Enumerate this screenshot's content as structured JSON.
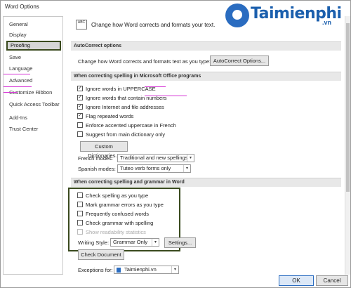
{
  "window": {
    "title": "Word Options"
  },
  "watermark": {
    "text": "Taimienphi",
    "suffix": ".vn"
  },
  "sidebar": {
    "items": [
      {
        "label": "General",
        "active": false
      },
      {
        "label": "Display",
        "active": false
      },
      {
        "label": "Proofing",
        "active": true
      },
      {
        "label": "Save",
        "active": false
      },
      {
        "label": "Language",
        "active": false
      },
      {
        "label": "Advanced",
        "active": false
      },
      {
        "label": "Customize Ribbon",
        "active": false
      },
      {
        "label": "Quick Access Toolbar",
        "active": false
      },
      {
        "label": "Add-Ins",
        "active": false
      },
      {
        "label": "Trust Center",
        "active": false
      }
    ]
  },
  "header": {
    "icon_text": "ABC",
    "text": "Change how Word corrects and formats your text."
  },
  "autocorrect": {
    "section_title": "AutoCorrect options",
    "description": "Change how Word corrects and formats text as you type:",
    "button_label": "AutoCorrect Options..."
  },
  "office_spelling": {
    "section_title": "When correcting spelling in Microsoft Office programs",
    "options": [
      {
        "label": "Ignore words in UPPERCASE",
        "checked": true
      },
      {
        "label": "Ignore words that contain numbers",
        "checked": true
      },
      {
        "label": "Ignore Internet and file addresses",
        "checked": true
      },
      {
        "label": "Flag repeated words",
        "checked": true
      },
      {
        "label": "Enforce accented uppercase in French",
        "checked": false
      },
      {
        "label": "Suggest from main dictionary only",
        "checked": false
      }
    ],
    "custom_dictionaries_label": "Custom Dictionaries...",
    "french_modes_label": "French modes:",
    "french_modes_value": "Traditional and new spellings",
    "spanish_modes_label": "Spanish modes:",
    "spanish_modes_value": "Tuteo verb forms only"
  },
  "word_spelling": {
    "section_title": "When correcting spelling and grammar in Word",
    "options": [
      {
        "label": "Check spelling as you type",
        "checked": false,
        "disabled": false
      },
      {
        "label": "Mark grammar errors as you type",
        "checked": false,
        "disabled": false
      },
      {
        "label": "Frequently confused words",
        "checked": false,
        "disabled": false
      },
      {
        "label": "Check grammar with spelling",
        "checked": false,
        "disabled": false
      },
      {
        "label": "Show readability statistics",
        "checked": false,
        "disabled": true
      }
    ],
    "writing_style_label": "Writing Style:",
    "writing_style_value": "Grammar Only",
    "settings_label": "Settings...",
    "check_document_label": "Check Document"
  },
  "exceptions": {
    "label": "Exceptions for:",
    "value": "Taimienphi.vn"
  },
  "footer": {
    "ok_label": "OK",
    "cancel_label": "Cancel"
  },
  "colors": {
    "highlight_border": "#3a4a1e",
    "annotation_line": "#d633d6",
    "accent": "#2a6cc0"
  }
}
